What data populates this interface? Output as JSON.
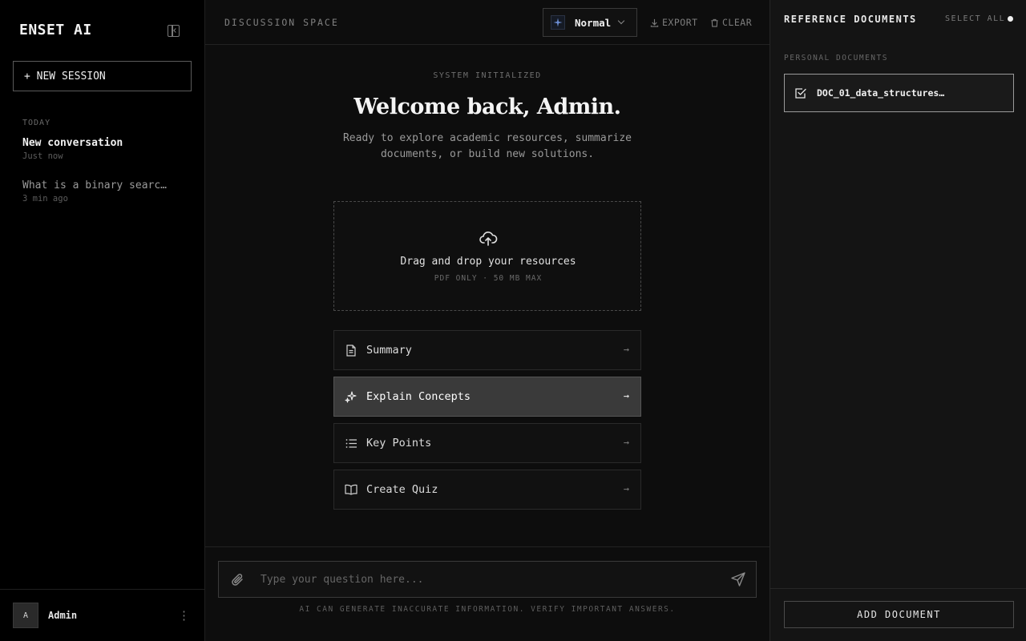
{
  "sidebar": {
    "brand": "ENSET AI",
    "new_session_label": "+ NEW SESSION",
    "section_label": "TODAY",
    "conversations": [
      {
        "title": "New conversation",
        "time": "Just now"
      },
      {
        "title": "What is a binary searc…",
        "time": "3 min ago"
      }
    ],
    "user": {
      "initial": "A",
      "name": "Admin",
      "menu_icon": "⋮"
    }
  },
  "header": {
    "title": "DISCUSSION SPACE",
    "mode": "Normal",
    "export_label": "EXPORT",
    "clear_label": "CLEAR"
  },
  "welcome": {
    "status": "SYSTEM INITIALIZED",
    "title": "Welcome back, Admin.",
    "subtitle": "Ready to explore academic resources, summarize documents, or build new solutions."
  },
  "dropzone": {
    "title": "Drag and drop your resources",
    "subtitle": "PDF ONLY · 50 MB MAX"
  },
  "actions": [
    {
      "label": "Summary",
      "icon": "document-icon",
      "arrow": "→"
    },
    {
      "label": "Explain Concepts",
      "icon": "sparkle-icon",
      "arrow": "→"
    },
    {
      "label": "Key Points",
      "icon": "list-icon",
      "arrow": "→"
    },
    {
      "label": "Create Quiz",
      "icon": "book-icon",
      "arrow": "→"
    }
  ],
  "composer": {
    "placeholder": "Type your question here...",
    "value": "",
    "disclaimer": "AI CAN GENERATE INACCURATE INFORMATION. VERIFY IMPORTANT ANSWERS."
  },
  "references": {
    "title": "REFERENCE DOCUMENTS",
    "select_all_label": "SELECT ALL",
    "section_label": "PERSONAL DOCUMENTS",
    "documents": [
      {
        "name": "DOC_01_data_structures…",
        "checked": true
      }
    ],
    "add_label": "ADD DOCUMENT"
  },
  "colors": {
    "background": "#000000",
    "main_bg": "#0d0d0d",
    "panel_bg": "#141414",
    "active_action": "#3a3a3a"
  }
}
